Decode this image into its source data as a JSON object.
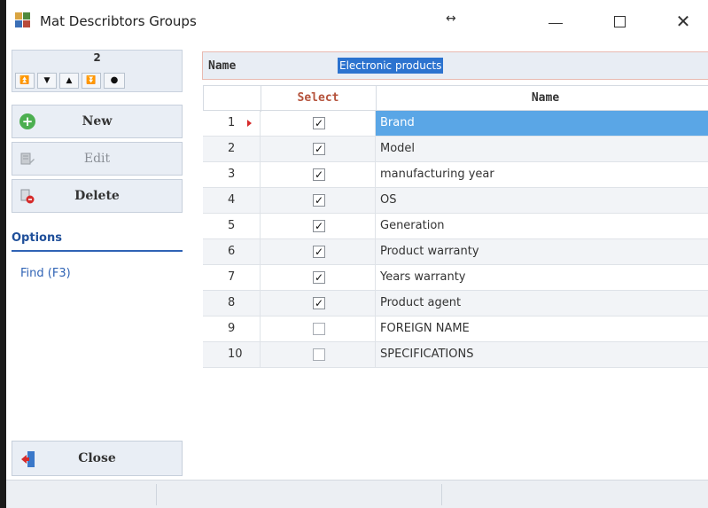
{
  "window": {
    "title": "Mat Describtors Groups",
    "resize_symbol": "↔",
    "minimize_icon": "minimize-icon",
    "maximize_icon": "maximize-icon",
    "close_symbol": "✕"
  },
  "left_panel": {
    "record_number": "2",
    "nav_buttons": [
      "⏫",
      "▼",
      "▲",
      "⏬",
      "●"
    ],
    "new_label": "New",
    "edit_label": "Edit",
    "delete_label": "Delete",
    "options_header": "Options",
    "find_label": "Find  (F3)",
    "close_label": "Close"
  },
  "form": {
    "name_label": "Name",
    "name_value": "Electronic products"
  },
  "grid": {
    "columns": [
      "",
      "Select",
      "Name"
    ],
    "rows": [
      {
        "num": "1",
        "checked": true,
        "name": "Brand",
        "selected": true
      },
      {
        "num": "2",
        "checked": true,
        "name": "Model",
        "selected": false
      },
      {
        "num": "3",
        "checked": true,
        "name": "manufacturing year",
        "selected": false
      },
      {
        "num": "4",
        "checked": true,
        "name": "OS",
        "selected": false
      },
      {
        "num": "5",
        "checked": true,
        "name": "Generation",
        "selected": false
      },
      {
        "num": "6",
        "checked": true,
        "name": "Product warranty",
        "selected": false
      },
      {
        "num": "7",
        "checked": true,
        "name": "Years warranty",
        "selected": false
      },
      {
        "num": "8",
        "checked": true,
        "name": "Product agent",
        "selected": false
      },
      {
        "num": "9",
        "checked": false,
        "name": "FOREIGN NAME",
        "selected": false
      },
      {
        "num": "10",
        "checked": false,
        "name": "SPECIFICATIONS",
        "selected": false
      }
    ]
  },
  "colors": {
    "accent": "#2f63b5",
    "selection": "#5aa6e6",
    "select_header": "#b5533c",
    "new_icon": "#4caf50",
    "delete_icon": "#d62b2b"
  }
}
